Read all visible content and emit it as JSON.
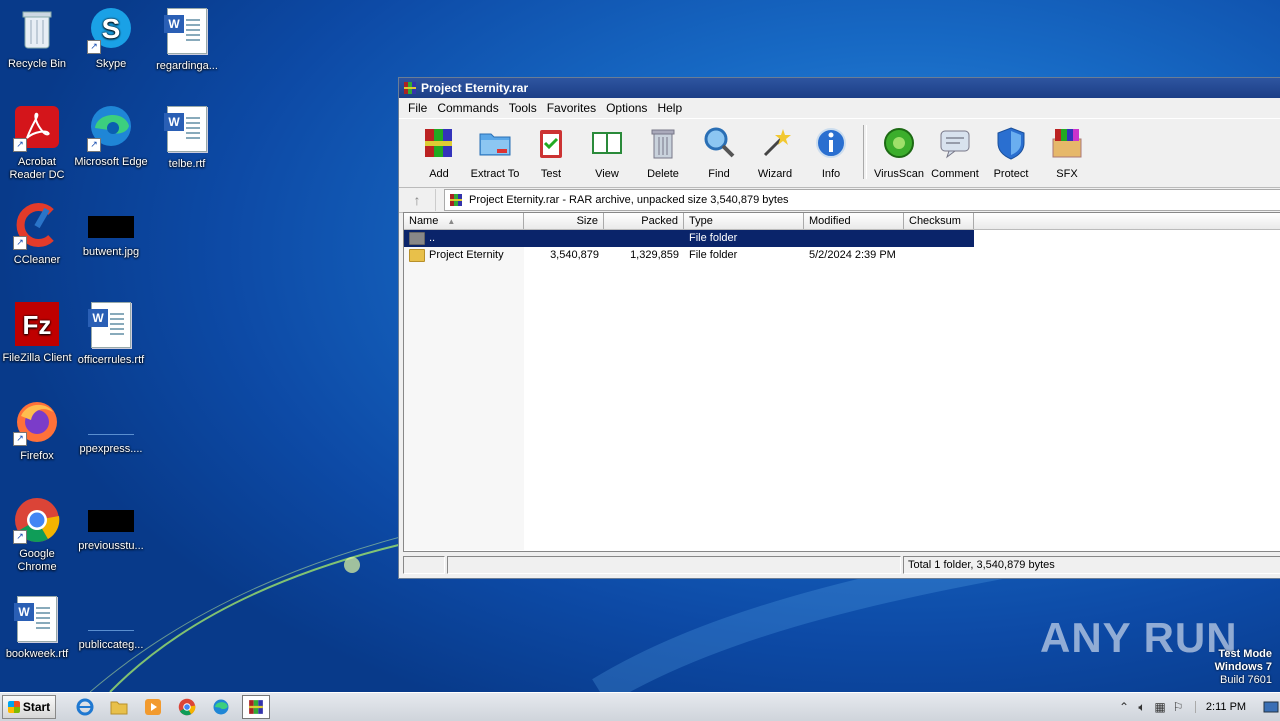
{
  "desktop": {
    "icons": [
      {
        "label": "Recycle Bin",
        "icon": "recycle-bin-icon"
      },
      {
        "label": "Skype",
        "icon": "skype-icon"
      },
      {
        "label": "regardinga...",
        "icon": "word-doc-icon"
      },
      {
        "label": "Acrobat Reader DC",
        "icon": "acrobat-icon"
      },
      {
        "label": "Microsoft Edge",
        "icon": "edge-icon"
      },
      {
        "label": "telbe.rtf",
        "icon": "word-doc-icon"
      },
      {
        "label": "CCleaner",
        "icon": "ccleaner-icon"
      },
      {
        "label": "butwent.jpg",
        "icon": "image-thumbnail-icon"
      },
      {
        "label": "FileZilla Client",
        "icon": "filezilla-icon"
      },
      {
        "label": "officerrules.rtf",
        "icon": "word-doc-icon"
      },
      {
        "label": "Firefox",
        "icon": "firefox-icon"
      },
      {
        "label": "ppexpress....",
        "icon": "blank-file-icon"
      },
      {
        "label": "Google Chrome",
        "icon": "chrome-icon"
      },
      {
        "label": "previousstu...",
        "icon": "image-thumbnail-icon"
      },
      {
        "label": "bookweek.rtf",
        "icon": "word-doc-icon"
      },
      {
        "label": "publiccateg...",
        "icon": "blank-file-icon"
      }
    ]
  },
  "window": {
    "title": "Project Eternity.rar",
    "menu": [
      "File",
      "Commands",
      "Tools",
      "Favorites",
      "Options",
      "Help"
    ],
    "toolbar": [
      "Add",
      "Extract To",
      "Test",
      "View",
      "Delete",
      "Find",
      "Wizard",
      "Info",
      "VirusScan",
      "Comment",
      "Protect",
      "SFX"
    ],
    "address": "Project Eternity.rar - RAR archive, unpacked size 3,540,879 bytes",
    "columns": [
      "Name",
      "Size",
      "Packed",
      "Type",
      "Modified",
      "Checksum"
    ],
    "rows": [
      {
        "name": "..",
        "size": "",
        "packed": "",
        "type": "File folder",
        "modified": "",
        "checksum": ""
      },
      {
        "name": "Project Eternity",
        "size": "3,540,879",
        "packed": "1,329,859",
        "type": "File folder",
        "modified": "5/2/2024 2:39 PM",
        "checksum": ""
      }
    ],
    "status": "Total 1 folder, 3,540,879 bytes"
  },
  "taskbar": {
    "start_label": "Start",
    "clock": "2:11 PM"
  },
  "watermark": {
    "line1": "Test Mode",
    "line2": "Windows 7",
    "line3": "Build 7601",
    "brand": "ANY RUN"
  }
}
